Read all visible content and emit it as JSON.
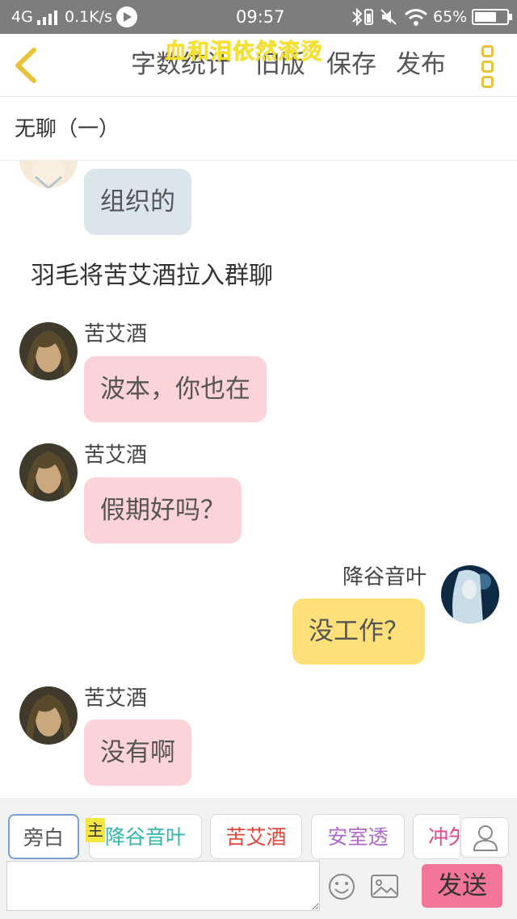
{
  "status_bar": {
    "network": "4G",
    "speed": "0.1K/s",
    "time": "09:57",
    "battery": "65%"
  },
  "toolbar": {
    "banner": "血和泪依然滚烫",
    "word_count": "字数统计",
    "old_version": "旧版",
    "save": "保存",
    "publish": "发布"
  },
  "chapter_title": "无聊（一）",
  "messages": [
    {
      "text": "组织的"
    },
    {
      "system": "羽毛将苦艾酒拉入群聊"
    },
    {
      "name": "苦艾酒",
      "text": "波本，你也在"
    },
    {
      "name": "苦艾酒",
      "text": "假期好吗？"
    },
    {
      "name": "降谷音叶",
      "text": "没工作？"
    },
    {
      "name": "苦艾酒",
      "text": "没有啊"
    }
  ],
  "roles": [
    {
      "label": "旁白",
      "color": "#555555"
    },
    {
      "label": "降谷音叶",
      "color": "#2fb8a8"
    },
    {
      "label": "苦艾酒",
      "color": "#e0483a"
    },
    {
      "label": "安室透",
      "color": "#b06ac8"
    },
    {
      "label": "冲矢",
      "color": "#e04a8a"
    }
  ],
  "main_tag": "主",
  "input": {
    "placeholder": ""
  },
  "send_label": "发送",
  "colors": {
    "accent": "#e8c33a",
    "send": "#f37599",
    "bubble_pink": "#fcd3d9",
    "bubble_yellow": "#fde07a",
    "bubble_blue": "#dbe6ec"
  }
}
